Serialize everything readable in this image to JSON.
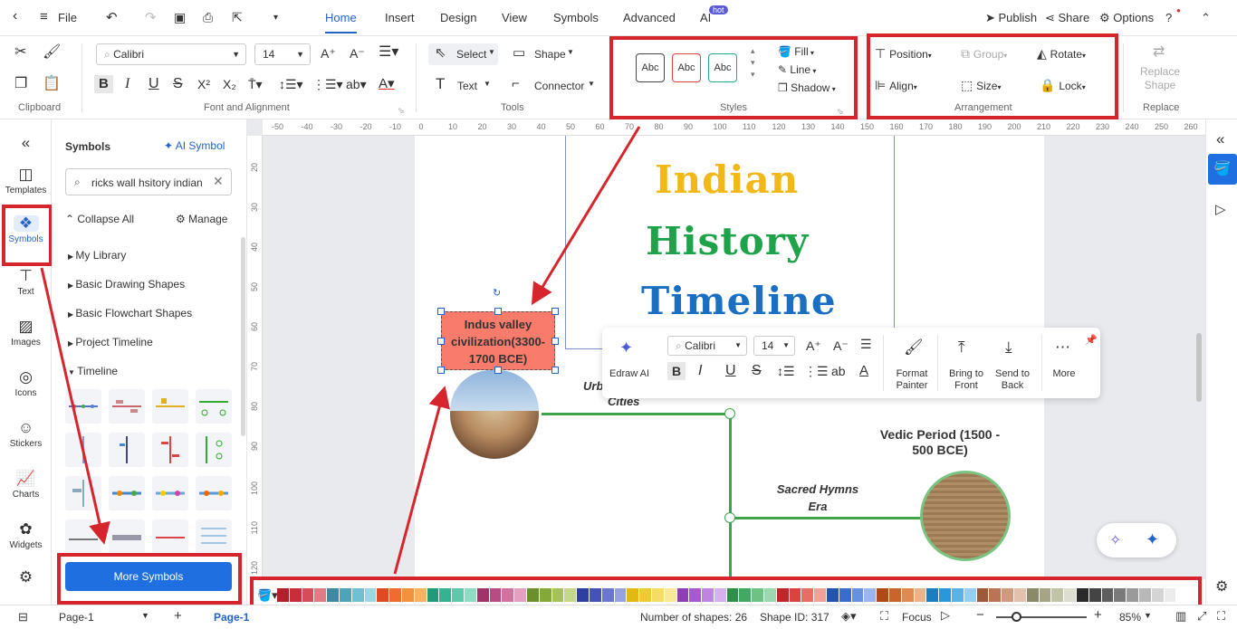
{
  "topbar": {
    "file": "File",
    "tabs": [
      "Home",
      "Insert",
      "Design",
      "View",
      "Symbols",
      "Advanced",
      "AI"
    ],
    "ai_badge": "hot",
    "publish": "Publish",
    "share": "Share",
    "options": "Options"
  },
  "ribbon": {
    "clipboard_label": "Clipboard",
    "font_name": "Calibri",
    "font_size": "14",
    "font_group_label": "Font and Alignment",
    "select": "Select",
    "shape": "Shape",
    "text": "Text",
    "connector": "Connector",
    "tools_label": "Tools",
    "style_samples": [
      "Abc",
      "Abc",
      "Abc"
    ],
    "fill": "Fill",
    "line": "Line",
    "shadow": "Shadow",
    "styles_label": "Styles",
    "position": "Position",
    "group": "Group",
    "rotate": "Rotate",
    "align": "Align",
    "size": "Size",
    "lock": "Lock",
    "arrangement_label": "Arrangement",
    "replace_shape": "Replace Shape",
    "replace_label": "Replace"
  },
  "rail": {
    "items": [
      "Templates",
      "Symbols",
      "Text",
      "Images",
      "Icons",
      "Stickers",
      "Charts",
      "Widgets"
    ]
  },
  "panel": {
    "title": "Symbols",
    "ai_symbol": "AI Symbol",
    "search_value": "ricks wall hsitory indian",
    "collapse_all": "Collapse All",
    "manage": "Manage",
    "categories": [
      "My Library",
      "Basic Drawing Shapes",
      "Basic Flowchart Shapes",
      "Project Timeline",
      "Timeline"
    ],
    "more_symbols": "More Symbols"
  },
  "ruler": {
    "top": [
      "-50",
      "-40",
      "-30",
      "-20",
      "-10",
      "0",
      "10",
      "20",
      "30",
      "40",
      "50",
      "60",
      "70",
      "80",
      "90",
      "100",
      "110",
      "120",
      "130",
      "140",
      "150",
      "160",
      "170",
      "180",
      "190",
      "200",
      "210",
      "220",
      "230",
      "240",
      "250",
      "260"
    ],
    "left": [
      "20",
      "30",
      "40",
      "50",
      "60",
      "70",
      "80",
      "90",
      "100",
      "110",
      "120",
      "130"
    ]
  },
  "canvas": {
    "title_line1": "Indian",
    "title_line2": "History",
    "title_line3": "Timeline",
    "selected_box": "Indus valley civilization(3300-1700 BCE)",
    "urban_label_partial": "Urb",
    "cities_label": "Cities",
    "vedic_title": "Vedic Period (1500 - 500 BCE)",
    "sacred_hymns": "Sacred Hymns Era",
    "colors": {
      "indian": "#f2b81a",
      "history": "#1ea34a",
      "timeline": "#1a6fc2",
      "box_fill": "#f97b6b"
    }
  },
  "floatbar": {
    "edraw_ai": "Edraw AI",
    "font_name": "Calibri",
    "font_size": "14",
    "format_painter": "Format Painter",
    "bring_to_front": "Bring to Front",
    "send_to_back": "Send to Back",
    "more": "More"
  },
  "palette": {
    "colors": [
      "#b3202c",
      "#c92d3a",
      "#d64c5a",
      "#e07b86",
      "#3f8aa0",
      "#4fa3b8",
      "#6fc0d2",
      "#9ad7e3",
      "#e04a22",
      "#ef6b2f",
      "#f2913e",
      "#f6b363",
      "#1f9b7a",
      "#35b290",
      "#5dc9aa",
      "#8fdcc4",
      "#a0346a",
      "#b84b83",
      "#d073a0",
      "#e3a0c0",
      "#6b8f2a",
      "#84a83a",
      "#a4c15a",
      "#c5d88a",
      "#2f3fa0",
      "#4552b8",
      "#6a77cf",
      "#98a2e0",
      "#e3b812",
      "#f0cb2e",
      "#f5dc64",
      "#f8e99a",
      "#8e3fb8",
      "#a55bcf",
      "#bf84e0",
      "#d7b0ee",
      "#2e8f4a",
      "#43a862",
      "#6cc183",
      "#9ed7ad",
      "#c2252a",
      "#d9453d",
      "#e86d64",
      "#f1a09a",
      "#2454b0",
      "#3a6ccc",
      "#6890e0",
      "#9bb5ee",
      "#b04a14",
      "#c9652a",
      "#de8a52",
      "#ecb38a",
      "#1a7fc0",
      "#2a98d8",
      "#58b3e6",
      "#93cff0",
      "#a0583a",
      "#b87454",
      "#cf9a7e",
      "#e2c2ae",
      "#8a8a6a",
      "#a5a585",
      "#c3c3a8",
      "#deded0",
      "#2a2a2a",
      "#444444",
      "#5e5e5e",
      "#7a7a7a",
      "#9a9a9a",
      "#b8b8b8",
      "#d4d4d4",
      "#ececec"
    ]
  },
  "status": {
    "page_selector": "Page-1",
    "page_tab": "Page-1",
    "shape_count": "Number of shapes: 26",
    "shape_id": "Shape ID: 317",
    "focus": "Focus",
    "zoom": "85%"
  }
}
